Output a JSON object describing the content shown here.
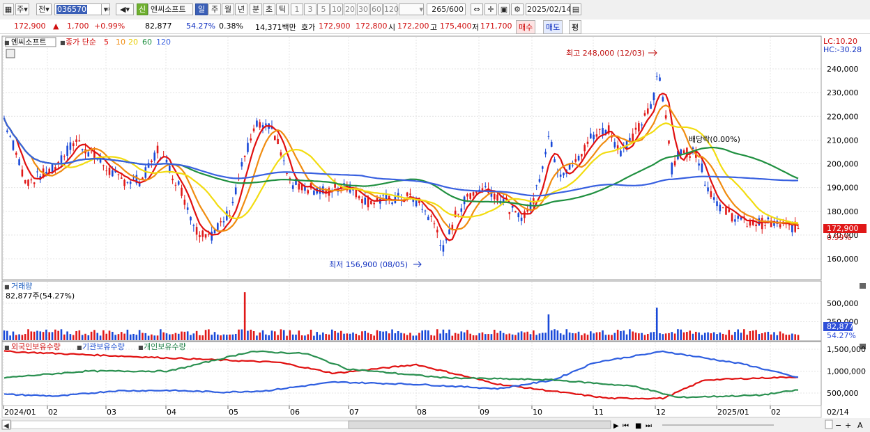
{
  "toolbar": {
    "menu_label": "주",
    "mode_label": "전",
    "code": "036570",
    "stock_name": "엔씨소프트",
    "sin_label": "신",
    "periods": [
      "일",
      "주",
      "월",
      "년",
      "분",
      "초",
      "틱"
    ],
    "intervals": [
      "1",
      "3",
      "5",
      "10",
      "20",
      "30",
      "60",
      "120"
    ],
    "count": "265/600",
    "date": "2025/02/14"
  },
  "infobar": {
    "price": "172,900",
    "change": "1,700",
    "change_pct": "+0.99%",
    "volume": "82,877",
    "vol_ratio": "54.27%",
    "turnover": "0.38%",
    "amount": "14,371백만",
    "hoga_label": "호가",
    "ask": "172,900",
    "bid": "172,800",
    "open_label": "시",
    "open": "172,200",
    "high_label": "고",
    "high": "175,400",
    "low_label": "저",
    "low": "171,700",
    "buy_label": "매수",
    "sell_label": "매도",
    "avg_label": "평"
  },
  "price_panel": {
    "title": "엔씨소프트",
    "legend_prefix": "종가 단순",
    "ma_labels": [
      "5",
      "10",
      "20",
      "60",
      "120"
    ],
    "lc": "LC:10.20",
    "hc": "HC:-30.28",
    "max_label": "최고 248,000 (12/03)",
    "min_label": "최저 156,900 (08/05)",
    "div_label": "배당락(0.00%)",
    "current_price": "172,900",
    "current_pct": "0.99%",
    "y_ticks": [
      "240,000",
      "230,000",
      "220,000",
      "210,000",
      "200,000",
      "190,000",
      "180,000",
      "170,000",
      "160,000"
    ]
  },
  "volume_panel": {
    "title": "거래량",
    "subtitle": "82,877주(54.27%)",
    "current": "82,877",
    "current_pct": "54.27%",
    "y_ticks": [
      "500,000",
      "250,000"
    ]
  },
  "holding_panel": {
    "legend": [
      "외국인보유수량",
      "기관보유수량",
      "개인보유수량"
    ],
    "y_ticks": [
      "1,500,000",
      "1,000,000",
      "500,000"
    ]
  },
  "x_axis": {
    "labels": [
      "2024/01",
      "02",
      "03",
      "04",
      "05",
      "06",
      "07",
      "08",
      "09",
      "10",
      "11",
      "12",
      "2025/01",
      "02"
    ],
    "right_label": "02/14"
  },
  "colors": {
    "up": "#e01818",
    "down": "#1848d8",
    "ma5": "#e01010",
    "ma10": "#f08c10",
    "ma20": "#f2dc10",
    "ma60": "#209040",
    "ma120": "#3860e0"
  }
}
